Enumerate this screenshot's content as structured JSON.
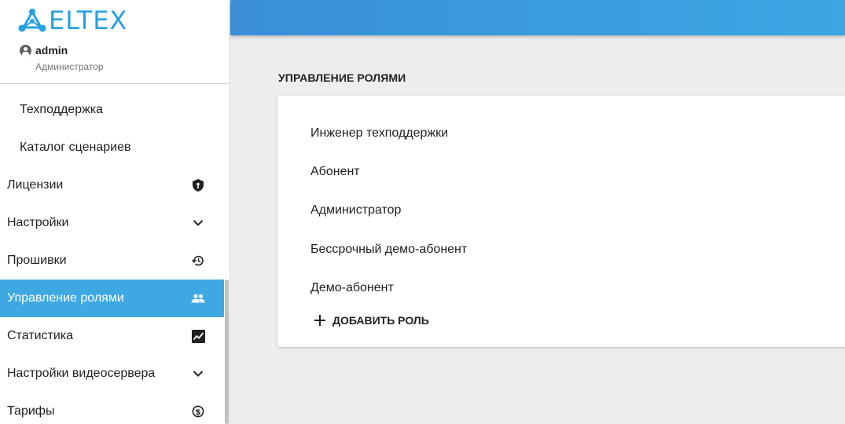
{
  "brand": {
    "name": "ELTEX",
    "color": "#27a0e0"
  },
  "user": {
    "name": "admin",
    "role": "Администратор"
  },
  "sidebar": {
    "items": [
      {
        "label": "Техподдержка",
        "icon": ""
      },
      {
        "label": "Каталог сценариев",
        "icon": ""
      },
      {
        "label": "Лицензии",
        "icon": "license-shield-icon"
      },
      {
        "label": "Настройки",
        "icon": "chevron-down-icon"
      },
      {
        "label": "Прошивки",
        "icon": "history-icon"
      },
      {
        "label": "Управление ролями",
        "icon": "people-icon",
        "active": true
      },
      {
        "label": "Статистика",
        "icon": "chart-icon"
      },
      {
        "label": "Настройки видеосервера",
        "icon": "chevron-down-icon"
      },
      {
        "label": "Тарифы",
        "icon": "dollar-icon"
      }
    ],
    "active_color": "#3ea8e2"
  },
  "header": {
    "gradient": [
      "#3a8fd8",
      "#3ba7e3"
    ]
  },
  "main": {
    "title": "УПРАВЛЕНИЕ РОЛЯМИ",
    "roles": [
      "Инженер техподдержки",
      "Абонент",
      "Администратор",
      "Бессрочный демо-абонент",
      "Демо-абонент"
    ],
    "add_role_label": "ДОБАВИТЬ РОЛЬ"
  }
}
